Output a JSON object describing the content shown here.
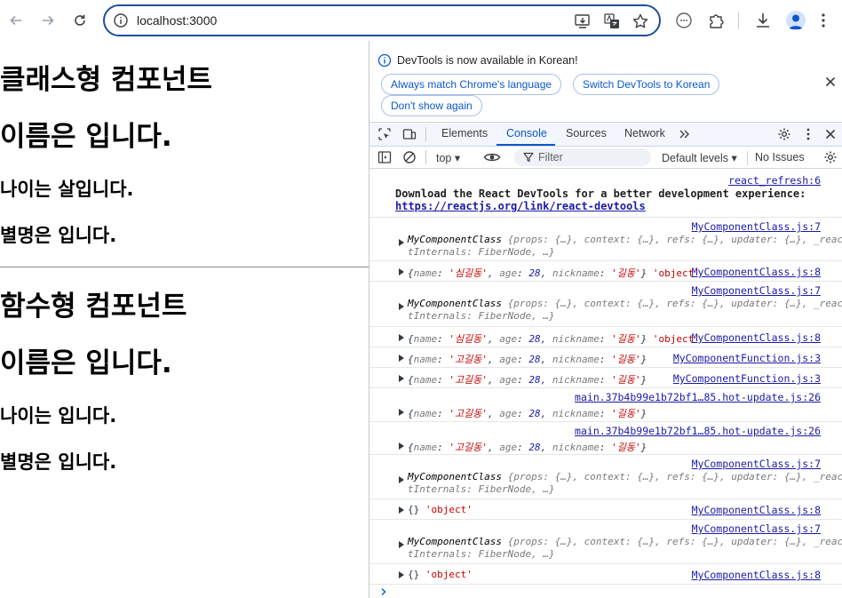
{
  "browser": {
    "url": "localhost:3000",
    "nav": {
      "back": "back-arrow-icon",
      "forward": "forward-arrow-icon",
      "reload": "reload-icon"
    },
    "accent": "#1f4fa0"
  },
  "page": {
    "class_heading": "클래스형 컴포넌트",
    "class_name": "이름은 입니다.",
    "class_age": "나이는 살입니다.",
    "class_nick": "별명은 입니다.",
    "func_heading": "함수형 컴포넌트",
    "func_name": "이름은 입니다.",
    "func_age": "나이는 입니다.",
    "func_nick": "별명은 입니다."
  },
  "devtools": {
    "info": {
      "message": "DevTools is now available in Korean!",
      "btn_match": "Always match Chrome's language",
      "btn_switch": "Switch DevTools to Korean",
      "btn_dont": "Don't show again"
    },
    "tabs": [
      "Elements",
      "Console",
      "Sources",
      "Network"
    ],
    "active_tab": "Console",
    "context": "top",
    "filter_placeholder": "Filter",
    "levels": "Default levels",
    "issues": "No Issues",
    "console": {
      "refresh_src": "react_refresh:6",
      "download_text": "Download the React DevTools for a better development experience:",
      "download_link": "https://reactjs.org/link/react-devtools",
      "src_class7": "MyComponentClass.js:7",
      "src_class8": "MyComponentClass.js:8",
      "src_func3": "MyComponentFunction.js:3",
      "src_hot": "main.37b4b99e1b72bf1…85.hot-update.js:26",
      "class_obj_1": "MyComponentClass",
      "class_obj_2": "{props: {…}, context: {…}, refs: {…}, updater: {…}, _reac",
      "class_obj_3": "tInternals: FiberNode, …}",
      "name_key": "name",
      "age_key": "age",
      "nick_key": "nickname",
      "name_val_1": "'심길동'",
      "name_val_2": "'고길동'",
      "age_val": "28",
      "nick_val": "'길동'",
      "type_object": "'object'",
      "empty_obj": "{}"
    }
  }
}
